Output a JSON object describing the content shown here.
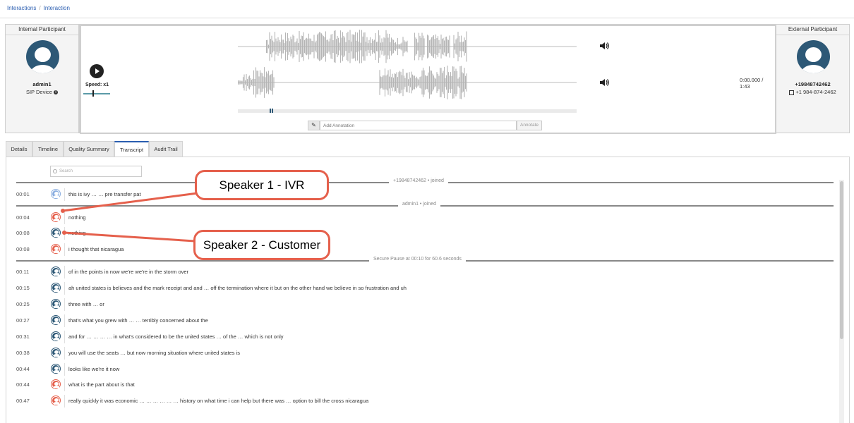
{
  "breadcrumb": {
    "items": [
      "Interactions",
      "Interaction"
    ],
    "separator": "/"
  },
  "internal": {
    "title": "Internal Participant",
    "name": "admin1",
    "device": "SIP Device"
  },
  "external": {
    "title": "External Participant",
    "number": "+19848742462",
    "formatted": "+1 984-874-2462"
  },
  "player": {
    "speed_label": "Speed: x1",
    "time": "0:00.000 / 1:43",
    "annotation_placeholder": "Add Annotation",
    "annotate_button": "Annotate"
  },
  "tabs": [
    {
      "label": "Details",
      "active": false
    },
    {
      "label": "Timeline",
      "active": false
    },
    {
      "label": "Quality Summary",
      "active": false
    },
    {
      "label": "Transcript",
      "active": true
    },
    {
      "label": "Audit Trail",
      "active": false
    }
  ],
  "transcript": {
    "search_placeholder": "Search",
    "events": {
      "joined_external": "+19848742462 • joined",
      "joined_admin": "admin1 • joined",
      "secure_pause": "Secure Pause at 00:10 for 60.6 seconds"
    },
    "rows": [
      {
        "time": "00:01",
        "speaker": "ivr",
        "text": "this is ivy … … pre transfer pat"
      },
      {
        "time": "00:04",
        "speaker": "agent",
        "text": "nothing"
      },
      {
        "time": "00:08",
        "speaker": "customer",
        "text": "nothing"
      },
      {
        "time": "00:08",
        "speaker": "agent",
        "text": "i thought that nicaragua"
      },
      {
        "time": "00:11",
        "speaker": "customer",
        "text": "of in the points in now we're we're in the storm over"
      },
      {
        "time": "00:15",
        "speaker": "customer",
        "text": "ah united states is believes and the mark receipt and and … off the termination where it but on the other hand we believe in so frustration and uh"
      },
      {
        "time": "00:25",
        "speaker": "customer",
        "text": "three with … or"
      },
      {
        "time": "00:27",
        "speaker": "customer",
        "text": "that's what you grew with … … terribly concerned about the"
      },
      {
        "time": "00:31",
        "speaker": "customer",
        "text": "and for … … … … in what's considered to be the united states … of the … which is not only"
      },
      {
        "time": "00:38",
        "speaker": "customer",
        "text": "you will use the seats … but now morning situation where united states is"
      },
      {
        "time": "00:44",
        "speaker": "customer",
        "text": "looks like we're it now"
      },
      {
        "time": "00:44",
        "speaker": "agent",
        "text": "what is the part about is that"
      },
      {
        "time": "00:47",
        "speaker": "agent",
        "text": "really quickly it was economic … … … … … … history on what time i can help but there was … option to bill the cross nicaragua"
      }
    ]
  },
  "callouts": {
    "speaker1": "Speaker 1 - IVR",
    "speaker2": "Speaker 2 - Customer"
  },
  "colors": {
    "avatar": "#2d5876",
    "agent": "#e5604c",
    "ivr": "#8aaee0",
    "customer": "#2d5876",
    "callout": "#e5604c",
    "link": "#2a5db0"
  }
}
